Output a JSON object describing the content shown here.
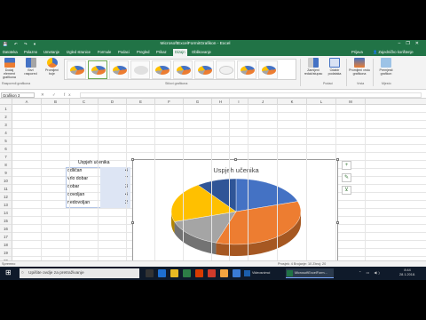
{
  "window": {
    "title": "MicrosoftExcelFormitGrafikon - Excel",
    "context_tab": "Alati za grafikone",
    "controls": [
      "–",
      "❐",
      "✕"
    ]
  },
  "tabs": [
    "Datoteka",
    "Polazno",
    "Umetanje",
    "Izgled stranice",
    "Formule",
    "Podaci",
    "Pregled",
    "Prikaz",
    "Dizajn",
    "Oblikovanje"
  ],
  "tabs_right": {
    "tell_me": "Recite mi što želite učiniti",
    "signin": "Prijava",
    "share": "Zajedničko korištenje"
  },
  "ribbon": {
    "buttons": [
      {
        "label": "Dodaj element grafikona"
      },
      {
        "label": "Brzi raspored"
      },
      {
        "label": "Promijeni boje"
      }
    ],
    "right_buttons": [
      {
        "label": "Zamijeni redak/stupac"
      },
      {
        "label": "Odabir podataka"
      },
      {
        "label": "Promijeni vrstu grafikona"
      },
      {
        "label": "Premjesti grafikon"
      }
    ],
    "groups": [
      "Rasporedi grafikona",
      "Stilovi grafikona",
      "Podaci",
      "Vrsta",
      "Mjesto"
    ]
  },
  "namebox": "Grafikon 3",
  "fx_icons": "✕ ✓ fx",
  "columns": [
    "A",
    "B",
    "C",
    "D",
    "E",
    "F",
    "G",
    "H",
    "I",
    "J",
    "K",
    "L",
    "M"
  ],
  "rows": [
    "1",
    "2",
    "3",
    "4",
    "5",
    "6",
    "7",
    "8",
    "9",
    "10",
    "11",
    "12",
    "13",
    "14",
    "15",
    "16",
    "17",
    "18",
    "19",
    "20",
    "21"
  ],
  "table": {
    "heading": "Uspjeh učenika",
    "rows": [
      {
        "grade": "odličan",
        "count": "4"
      },
      {
        "grade": "vrlo dobar",
        "count": "7"
      },
      {
        "grade": "dobar",
        "count": "3"
      },
      {
        "grade": "dovoljan",
        "count": "4"
      },
      {
        "grade": "nedovoljan",
        "count": "2"
      }
    ]
  },
  "chart_data": {
    "type": "pie",
    "title": "Uspjeh učenika",
    "categories": [
      "odličan",
      "vrlo dobar",
      "dobar",
      "dovoljan",
      "nedovoljan"
    ],
    "values": [
      4,
      7,
      3,
      4,
      2
    ],
    "colors": [
      "#4472c4",
      "#ed7d31",
      "#a5a5a5",
      "#ffc000",
      "#2f5597"
    ],
    "legend_position": "bottom",
    "style": "3d-pie"
  },
  "sheet_tab": "List1",
  "status": {
    "left": "Spremno",
    "right": "Prosjek: 4   Brojanje: 10   Zbroj: 20"
  },
  "taskbar": {
    "search": "Upišite ovdje za pretraživanje",
    "apps": [
      "Videosnimci",
      "MicrosoftExcelForm..."
    ],
    "clock_time": "8:44",
    "clock_date": "28.1.2018."
  }
}
